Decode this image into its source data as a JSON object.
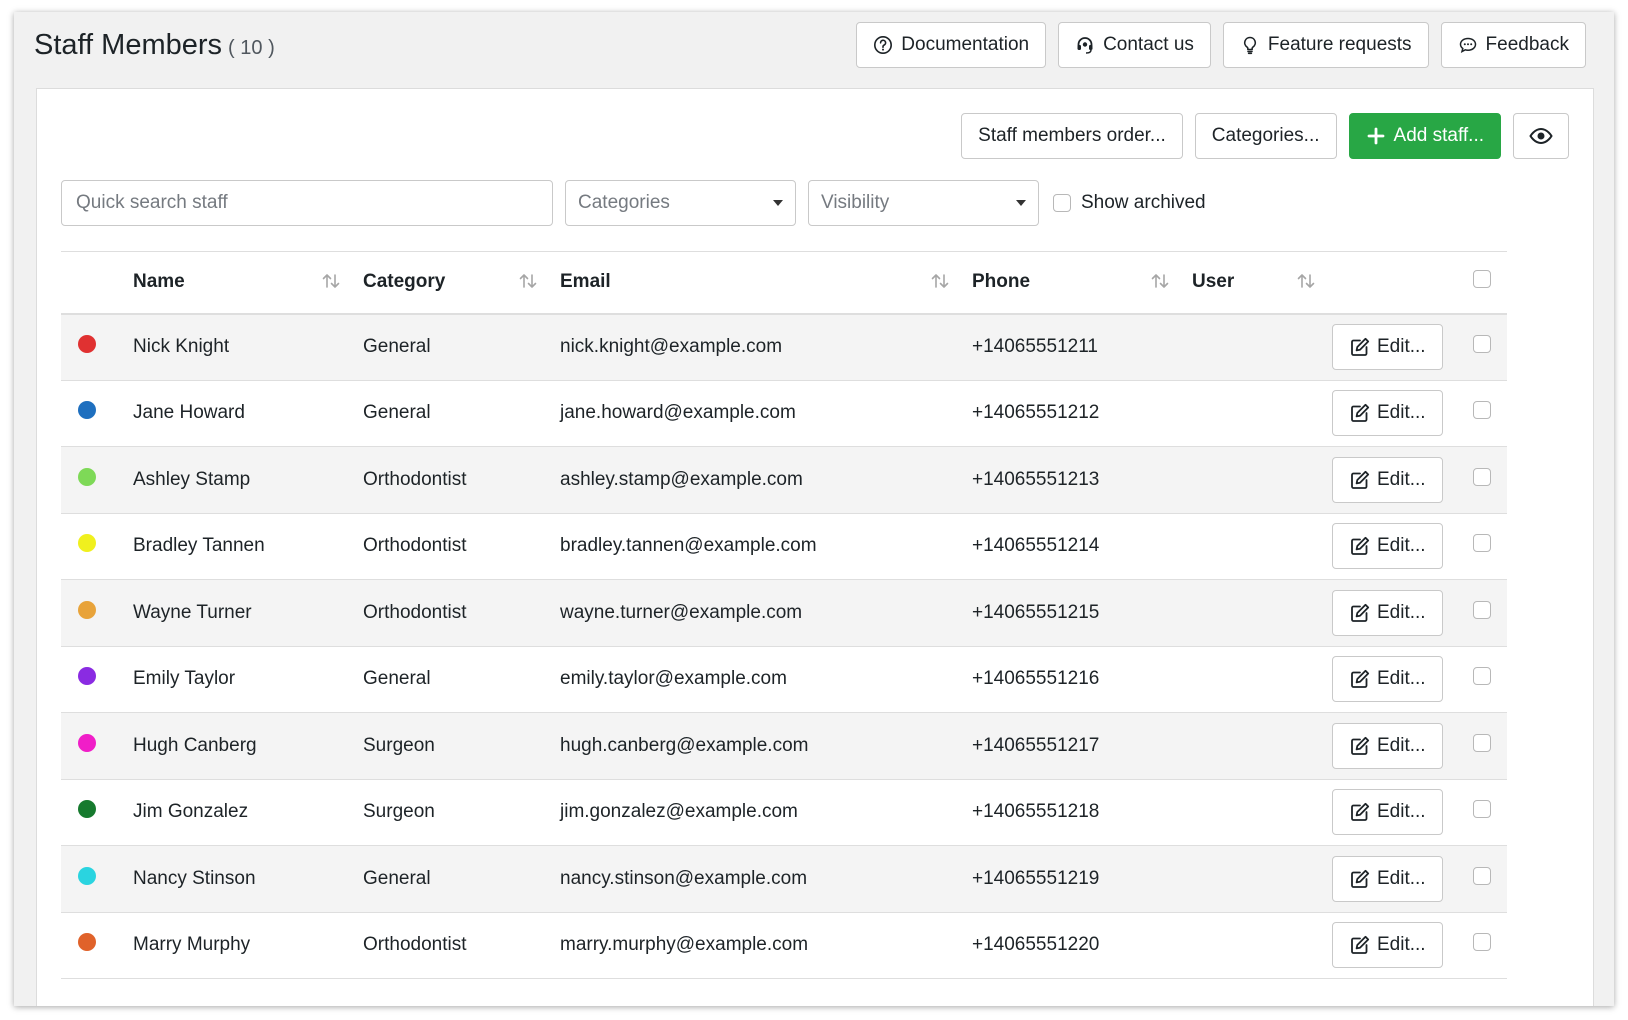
{
  "header": {
    "title": "Staff Members",
    "count": "( 10 )",
    "links": [
      {
        "label": "Documentation",
        "icon": "question-circle-icon"
      },
      {
        "label": "Contact us",
        "icon": "headset-icon"
      },
      {
        "label": "Feature requests",
        "icon": "lightbulb-icon"
      },
      {
        "label": "Feedback",
        "icon": "chat-bubble-icon"
      }
    ]
  },
  "toolbar": {
    "order_label": "Staff members order...",
    "categories_label": "Categories...",
    "add_label": "Add staff...",
    "add_color": "#28a745",
    "visibility_icon": "eye-icon"
  },
  "filters": {
    "search_placeholder": "Quick search staff",
    "categories_placeholder": "Categories",
    "visibility_placeholder": "Visibility",
    "show_archived_label": "Show archived"
  },
  "table": {
    "columns": {
      "name": "Name",
      "category": "Category",
      "email": "Email",
      "phone": "Phone",
      "user": "User"
    },
    "edit_label": "Edit...",
    "rows": [
      {
        "color": "#e03131",
        "name": "Nick Knight",
        "category": "General",
        "email": "nick.knight@example.com",
        "phone": "+14065551211",
        "user": ""
      },
      {
        "color": "#1e6fbf",
        "name": "Jane Howard",
        "category": "General",
        "email": "jane.howard@example.com",
        "phone": "+14065551212",
        "user": ""
      },
      {
        "color": "#7ed957",
        "name": "Ashley Stamp",
        "category": "Orthodontist",
        "email": "ashley.stamp@example.com",
        "phone": "+14065551213",
        "user": ""
      },
      {
        "color": "#f0f01e",
        "name": "Bradley Tannen",
        "category": "Orthodontist",
        "email": "bradley.tannen@example.com",
        "phone": "+14065551214",
        "user": ""
      },
      {
        "color": "#e8a33a",
        "name": "Wayne Turner",
        "category": "Orthodontist",
        "email": "wayne.turner@example.com",
        "phone": "+14065551215",
        "user": ""
      },
      {
        "color": "#8a2be2",
        "name": "Emily Taylor",
        "category": "General",
        "email": "emily.taylor@example.com",
        "phone": "+14065551216",
        "user": ""
      },
      {
        "color": "#f01ec8",
        "name": "Hugh Canberg",
        "category": "Surgeon",
        "email": "hugh.canberg@example.com",
        "phone": "+14065551217",
        "user": ""
      },
      {
        "color": "#167a2e",
        "name": "Jim Gonzalez",
        "category": "Surgeon",
        "email": "jim.gonzalez@example.com",
        "phone": "+14065551218",
        "user": ""
      },
      {
        "color": "#2ad4e0",
        "name": "Nancy Stinson",
        "category": "General",
        "email": "nancy.stinson@example.com",
        "phone": "+14065551219",
        "user": ""
      },
      {
        "color": "#e0622a",
        "name": "Marry Murphy",
        "category": "Orthodontist",
        "email": "marry.murphy@example.com",
        "phone": "+14065551220",
        "user": ""
      }
    ]
  }
}
